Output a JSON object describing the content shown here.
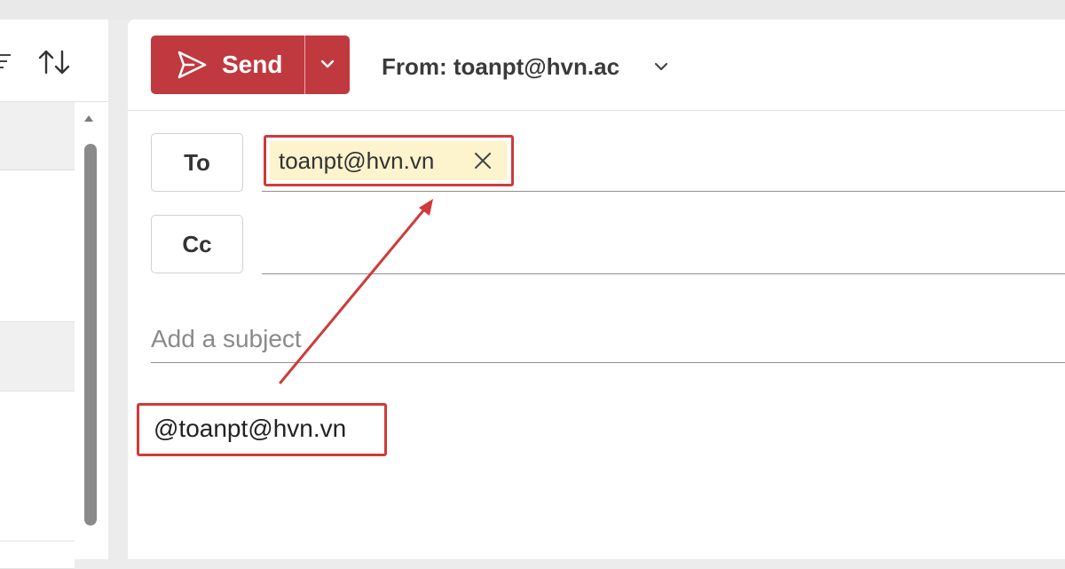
{
  "compose": {
    "send_label": "Send",
    "from_label": "From: toanpt@hvn.ac",
    "to_button": "To",
    "cc_button": "Cc",
    "recipient_chip": "toanpt@hvn.vn",
    "subject_placeholder": "Add a subject",
    "subject_value": "",
    "body_mention": "@toanpt@hvn.vn"
  },
  "icons": {
    "send": "send-icon",
    "send_dropdown": "chevron-down-icon",
    "from_dropdown": "chevron-down-icon",
    "remove_recipient": "close-icon",
    "filter": "filter-icon",
    "sort": "sort-icon"
  },
  "colors": {
    "send_button": "#c0393f",
    "highlight": "#d03a3a",
    "chip_background": "#fdf3cc"
  }
}
